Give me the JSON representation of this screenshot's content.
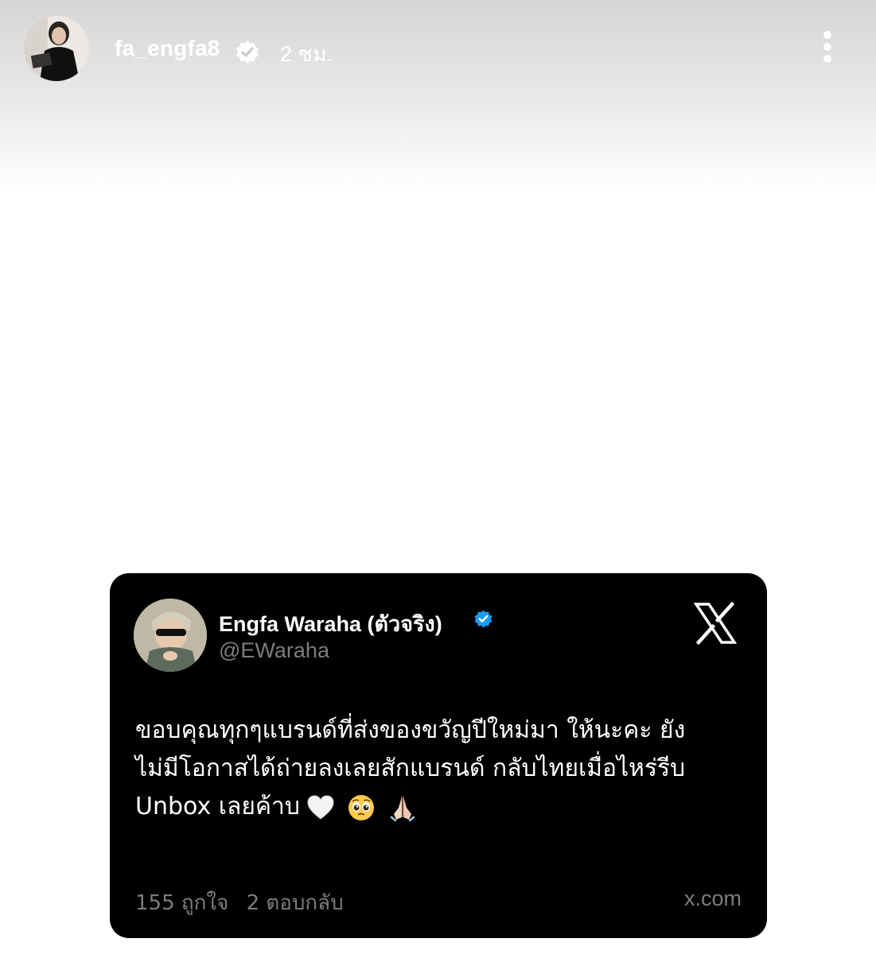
{
  "story": {
    "username": "fa_engfa8",
    "time_ago": "2 ชม.",
    "verified": true,
    "avatar_icon": "profile-photo-woman-black-blazer",
    "more_icon": "more-vertical-icon"
  },
  "tweet": {
    "display_name": "Engfa Waraha (ตัวจริง)",
    "handle": "@EWaraha",
    "verified_color": "#1d9bf0",
    "logo_icon": "x-logo-icon",
    "text_lines": [
      "ขอบคุณทุกๆแบรนด์ที่ส่งของขวัญปีใหม่มา ให้นะคะ ยัง",
      "ไม่มีโอกาสได้ถ่ายลงเลยสักแบรนด์ กลับไทยเมื่อไหร่รีบ",
      "Unbox เลยค้าบ"
    ],
    "emojis": [
      "white-heart",
      "pleading-face",
      "folded-hands"
    ],
    "likes_label": "155 ถูกใจ",
    "replies_label": "2 ตอบกลับ",
    "source": "x.com"
  },
  "colors": {
    "card_background": "#000000",
    "muted_text": "#7a7d80",
    "header_text": "#ffffff"
  }
}
